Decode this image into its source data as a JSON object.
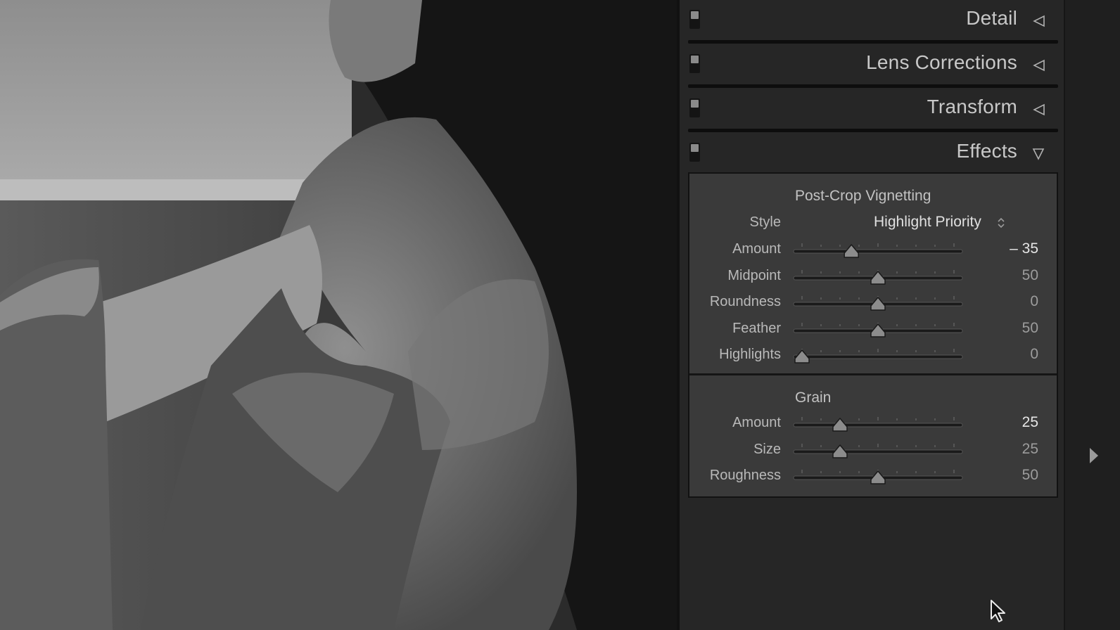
{
  "panel": {
    "sections": [
      {
        "title": "Detail",
        "state": "collapsed"
      },
      {
        "title": "Lens Corrections",
        "state": "collapsed"
      },
      {
        "title": "Transform",
        "state": "collapsed"
      },
      {
        "title": "Effects",
        "state": "expanded"
      }
    ]
  },
  "effects": {
    "vignetting": {
      "title": "Post-Crop Vignetting",
      "style_label": "Style",
      "style_value": "Highlight Priority",
      "sliders": [
        {
          "label": "Amount",
          "value": "– 35",
          "fraction": 0.325,
          "active": true
        },
        {
          "label": "Midpoint",
          "value": "50",
          "fraction": 0.5,
          "active": false
        },
        {
          "label": "Roundness",
          "value": "0",
          "fraction": 0.5,
          "active": false
        },
        {
          "label": "Feather",
          "value": "50",
          "fraction": 0.5,
          "active": false
        },
        {
          "label": "Highlights",
          "value": "0",
          "fraction": 0.0,
          "active": false
        }
      ]
    },
    "grain": {
      "title": "Grain",
      "sliders": [
        {
          "label": "Amount",
          "value": "25",
          "fraction": 0.25,
          "active": true
        },
        {
          "label": "Size",
          "value": "25",
          "fraction": 0.25,
          "active": false
        },
        {
          "label": "Roughness",
          "value": "50",
          "fraction": 0.5,
          "active": false
        }
      ]
    }
  },
  "icons": {
    "section_collapsed": "triangle-left-icon",
    "section_expanded": "triangle-down-icon",
    "panel_toggle": "triangle-right-icon",
    "cursor": "mouse-pointer-icon"
  },
  "colors": {
    "panel_bg": "#262626",
    "group_bg": "#3a3a3a",
    "label": "#b9b9b9",
    "value": "#9c9c9c",
    "value_active": "#e6e6e6"
  }
}
